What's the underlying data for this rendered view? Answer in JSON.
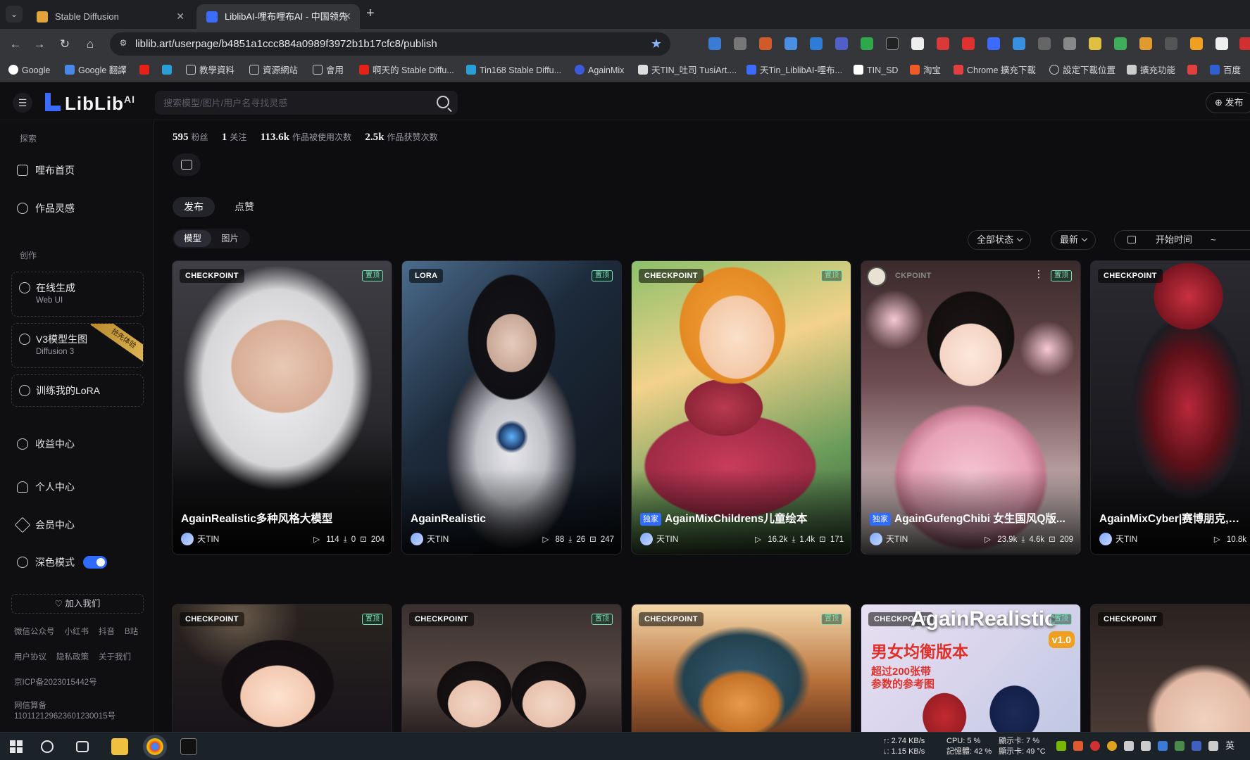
{
  "browser": {
    "tabs": [
      {
        "label": "Stable Diffusion",
        "active": false
      },
      {
        "label": "LiblibAI-哩布哩布AI - 中国领先",
        "active": true
      }
    ],
    "url": "liblib.art/userpage/b4851a1ccc884a0989f3972b1b17cfc8/publish",
    "bookmarks": [
      "Google",
      "Google 翻譯",
      "",
      "",
      "教學資料",
      "資源網站",
      "會用",
      "啊天的 Stable Diffu...",
      "Tin168 Stable Diffu...",
      "AgainMix",
      "天TIN_吐司 TusiArt....",
      "天Tin_LiblibAI-哩布...",
      "TIN_SD",
      "淘宝",
      "Chrome 擴充下載",
      "設定下載位置",
      "擴充功能",
      "百度"
    ]
  },
  "header": {
    "logo_text": "LibLib",
    "logo_suffix": "AI",
    "search_placeholder": "搜索模型/图片/用户名寻找灵感",
    "publish_label": "发布"
  },
  "sidebar": {
    "section_explore": "探索",
    "item_home": "哩布首页",
    "item_inspire": "作品灵感",
    "section_create": "创作",
    "card_online": {
      "title": "在线生成",
      "sub": "Web UI"
    },
    "card_v3": {
      "title": "V3模型生图",
      "sub": "Diffusion 3",
      "ribbon": "抢先体验"
    },
    "card_lora": {
      "title": "训练我的LoRA"
    },
    "item_income": "收益中心",
    "item_profile": "个人中心",
    "item_member": "会员中心",
    "item_dark": "深色模式",
    "join": "加入我们",
    "footer_links": [
      "微信公众号",
      "小红书",
      "抖音",
      "B站"
    ],
    "footer_links2": [
      "用户协议",
      "隐私政策",
      "关于我们"
    ],
    "icp": "京ICP备2023015442号",
    "netinfo": "网信算备",
    "netinfo_num": "110112129623601230015号"
  },
  "main": {
    "stats": [
      {
        "value": "595",
        "label": "粉丝"
      },
      {
        "value": "1",
        "label": "关注"
      },
      {
        "value": "113.6k",
        "label": "作品被使用次数"
      },
      {
        "value": "2.5k",
        "label": "作品获赞次数"
      }
    ],
    "tabs": [
      "发布",
      "点赞"
    ],
    "subtabs": [
      "模型",
      "图片"
    ],
    "filter_status": "全部状态",
    "filter_sort": "最新",
    "filter_start": "开始时间",
    "filter_tilde": "~"
  },
  "cards": [
    {
      "type": "CHECKPOINT",
      "pin": "置顶",
      "exclusive": "",
      "title": "AgainRealistic多种风格大模型",
      "author": "天TIN",
      "runs": "114",
      "downloads": "0",
      "images": "204"
    },
    {
      "type": "LORA",
      "pin": "置顶",
      "exclusive": "",
      "title": "AgainRealistic",
      "author": "天TIN",
      "runs": "88",
      "downloads": "26",
      "images": "247"
    },
    {
      "type": "CHECKPOINT",
      "pin": "置顶",
      "exclusive": "独家",
      "title": "AgainMixChildrens儿童绘本",
      "author": "天TIN",
      "runs": "16.2k",
      "downloads": "1.4k",
      "images": "171"
    },
    {
      "type": "CKPOINT",
      "pin": "置顶",
      "exclusive": "独家",
      "title": "AgainGufengChibi 女生国风Q版...",
      "author": "天TIN",
      "runs": "23.9k",
      "downloads": "4.6k",
      "images": "209"
    },
    {
      "type": "CHECKPOINT",
      "pin": "",
      "exclusive": "",
      "title": "AgainMixCyber|赛博朋克,科幻",
      "author": "天TIN",
      "runs": "10.8k",
      "downloads": "",
      "images": ""
    }
  ],
  "cards_row2": [
    {
      "type": "CHECKPOINT",
      "pin": "置顶"
    },
    {
      "type": "CHECKPOINT",
      "pin": "置顶"
    },
    {
      "type": "CHECKPOINT",
      "pin": "置顶"
    },
    {
      "type": "CHECKPOINT",
      "pin": "置顶",
      "overlay_title": "AgainRealistic",
      "overlay_sub": "男女均衡版本",
      "overlay_note1": "超过200张带",
      "overlay_note2": "参数的参考图",
      "version": "v1.0"
    },
    {
      "type": "CHECKPOINT",
      "pin": ""
    }
  ],
  "taskbar": {
    "net_up": "↑: 2.74 KB/s",
    "net_down": "↓: 1.15 KB/s",
    "cpu": "CPU: 5 %",
    "mem": "記憶體: 42 %",
    "gpu": "顯示卡: 7 %",
    "gpu_temp": "顯示卡: 49 °C",
    "lang": "英"
  },
  "colors": {
    "accent": "#2f6bff",
    "pin": "#7fe0b8",
    "bg": "#0d0d10"
  }
}
